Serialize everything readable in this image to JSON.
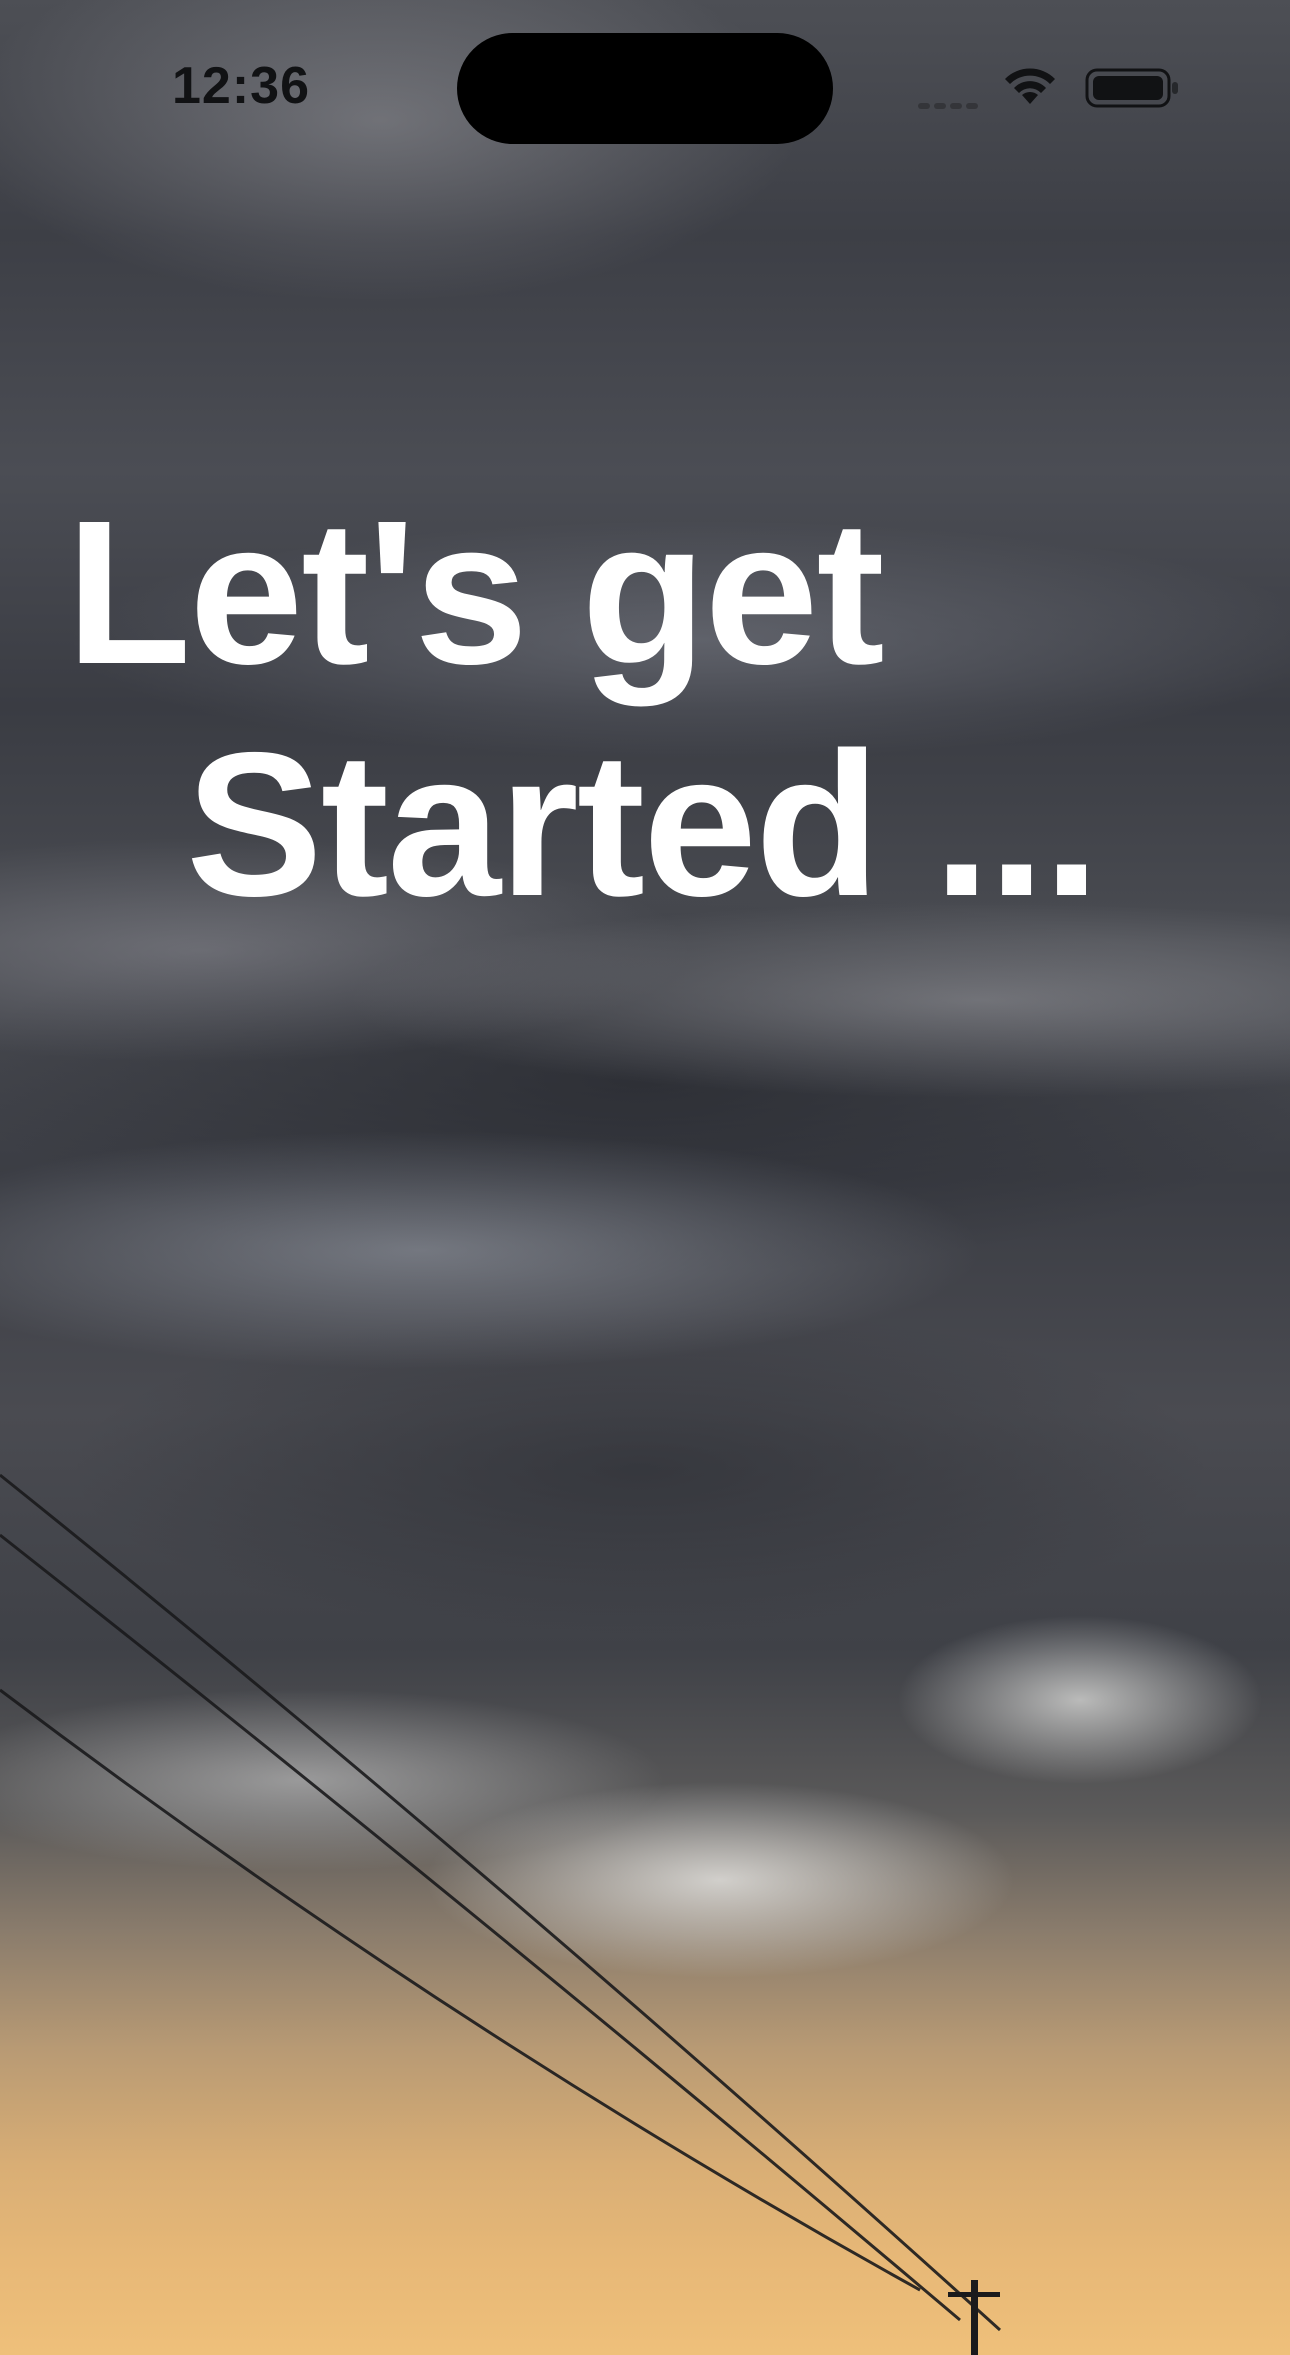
{
  "status_bar": {
    "time": "12:36",
    "icons": [
      "cellular-signal-icon",
      "wifi-icon",
      "battery-icon"
    ]
  },
  "welcome": {
    "headline_line1": "Let's get",
    "headline_line2": "Started ..."
  },
  "background": {
    "description_icon": "storm-clouds-photo",
    "colors": {
      "cloud_dark": "#3d3f46",
      "cloud_light": "#e8e8e6",
      "horizon_warm": "#e7b877",
      "headline_text": "#ffffff",
      "status_text": "#111214"
    }
  }
}
